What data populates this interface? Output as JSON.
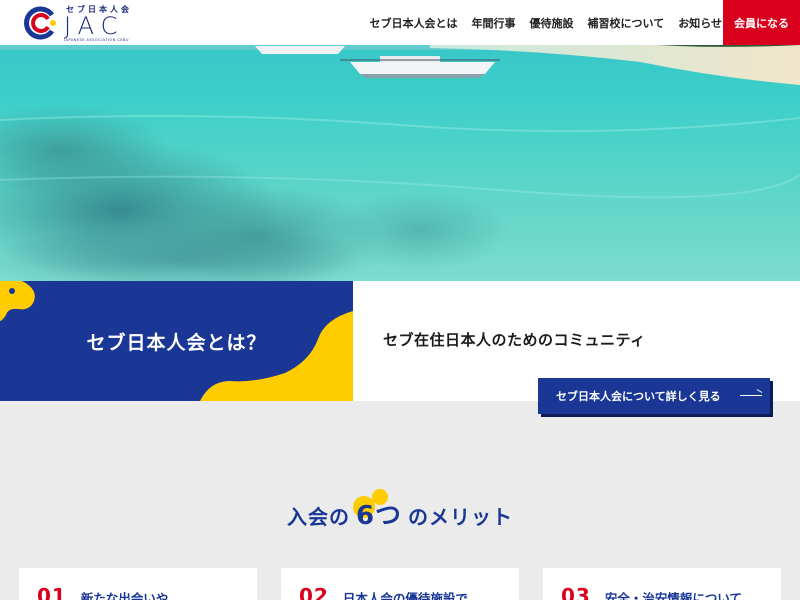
{
  "header": {
    "logo": {
      "ja_name": "セブ日本人会",
      "abbrev": "JAC",
      "en_name": "JAPANESE ASSOCIATION CEBU"
    },
    "nav": [
      {
        "label": "セブ日本人会とは"
      },
      {
        "label": "年間行事"
      },
      {
        "label": "優待施設"
      },
      {
        "label": "補習校について"
      },
      {
        "label": "お知らせ"
      }
    ],
    "join_label": "会員になる"
  },
  "colors": {
    "brand_blue": "#1a3796",
    "accent_red": "#d8001d",
    "accent_yellow": "#ffcc00"
  },
  "about": {
    "title": "セブ日本人会とは？",
    "tagline": "セブ在住日本人のためのコミュニティ",
    "button_label": "セブ日本人会について詳しく見る"
  },
  "merits": {
    "title_prefix": "入会の",
    "title_num": "6つ",
    "title_suffix": "のメリット",
    "cards": [
      {
        "num": "01",
        "title": "新たな出会いや"
      },
      {
        "num": "02",
        "title": "日本人会の優待施設で"
      },
      {
        "num": "03",
        "title": "安全・治安情報について"
      }
    ]
  }
}
